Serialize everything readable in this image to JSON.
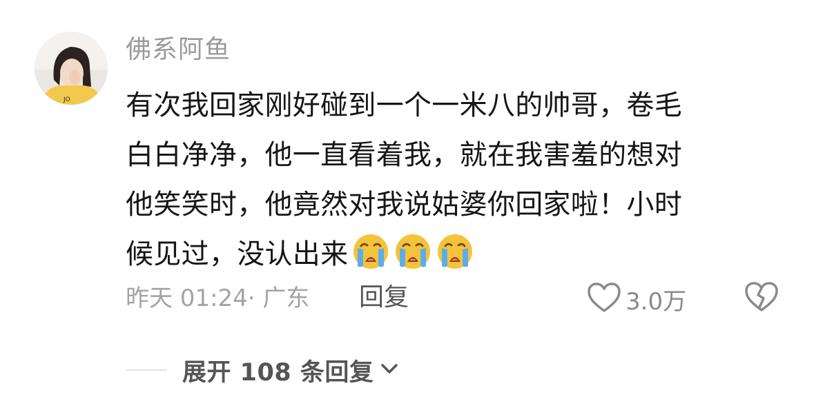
{
  "comment": {
    "username": "佛系阿鱼",
    "lines": [
      "有次我回家刚好碰到一个一米八的帅哥，卷毛",
      "白白净净，他一直看着我，就在我害羞的想对",
      "他笑笑时，他竟然对我说姑婆你回家啦！小时",
      "候见过，没认出来"
    ],
    "emojis": [
      "loudly-crying-face-icon",
      "loudly-crying-face-icon",
      "loudly-crying-face-icon"
    ],
    "time_location": "昨天 01:24· 广东",
    "reply_label": "回复",
    "like_count": "3.0万",
    "expand_label": "展开 108 条回复"
  },
  "colors": {
    "background": "#ffffff",
    "text": "#161616",
    "muted": "#9b9b9b",
    "action": "#555555",
    "icon": "#8a8a8a"
  }
}
